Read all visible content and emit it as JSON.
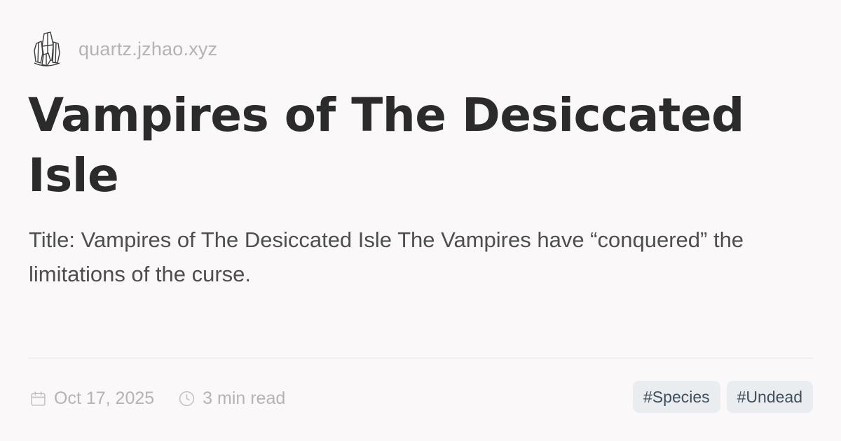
{
  "site": {
    "logo_icon": "crystal-cluster-icon",
    "name": "quartz.jzhao.xyz"
  },
  "page": {
    "title": "Vampires of The Desiccated Isle",
    "description": "Title: Vampires of The Desiccated Isle The Vampires have “conquered” the limitations of the curse."
  },
  "meta": {
    "date_icon": "calendar-icon",
    "date": "Oct 17, 2025",
    "reading_time_icon": "clock-icon",
    "reading_time": "3 min read"
  },
  "tags": [
    {
      "label": "#Species"
    },
    {
      "label": "#Undead"
    }
  ],
  "colors": {
    "background": "#faf8f8",
    "title_text": "#2b2b2b",
    "muted_text": "#b6b3b3",
    "tag_background": "#eaedf0",
    "tag_text": "#3f4f5c"
  }
}
